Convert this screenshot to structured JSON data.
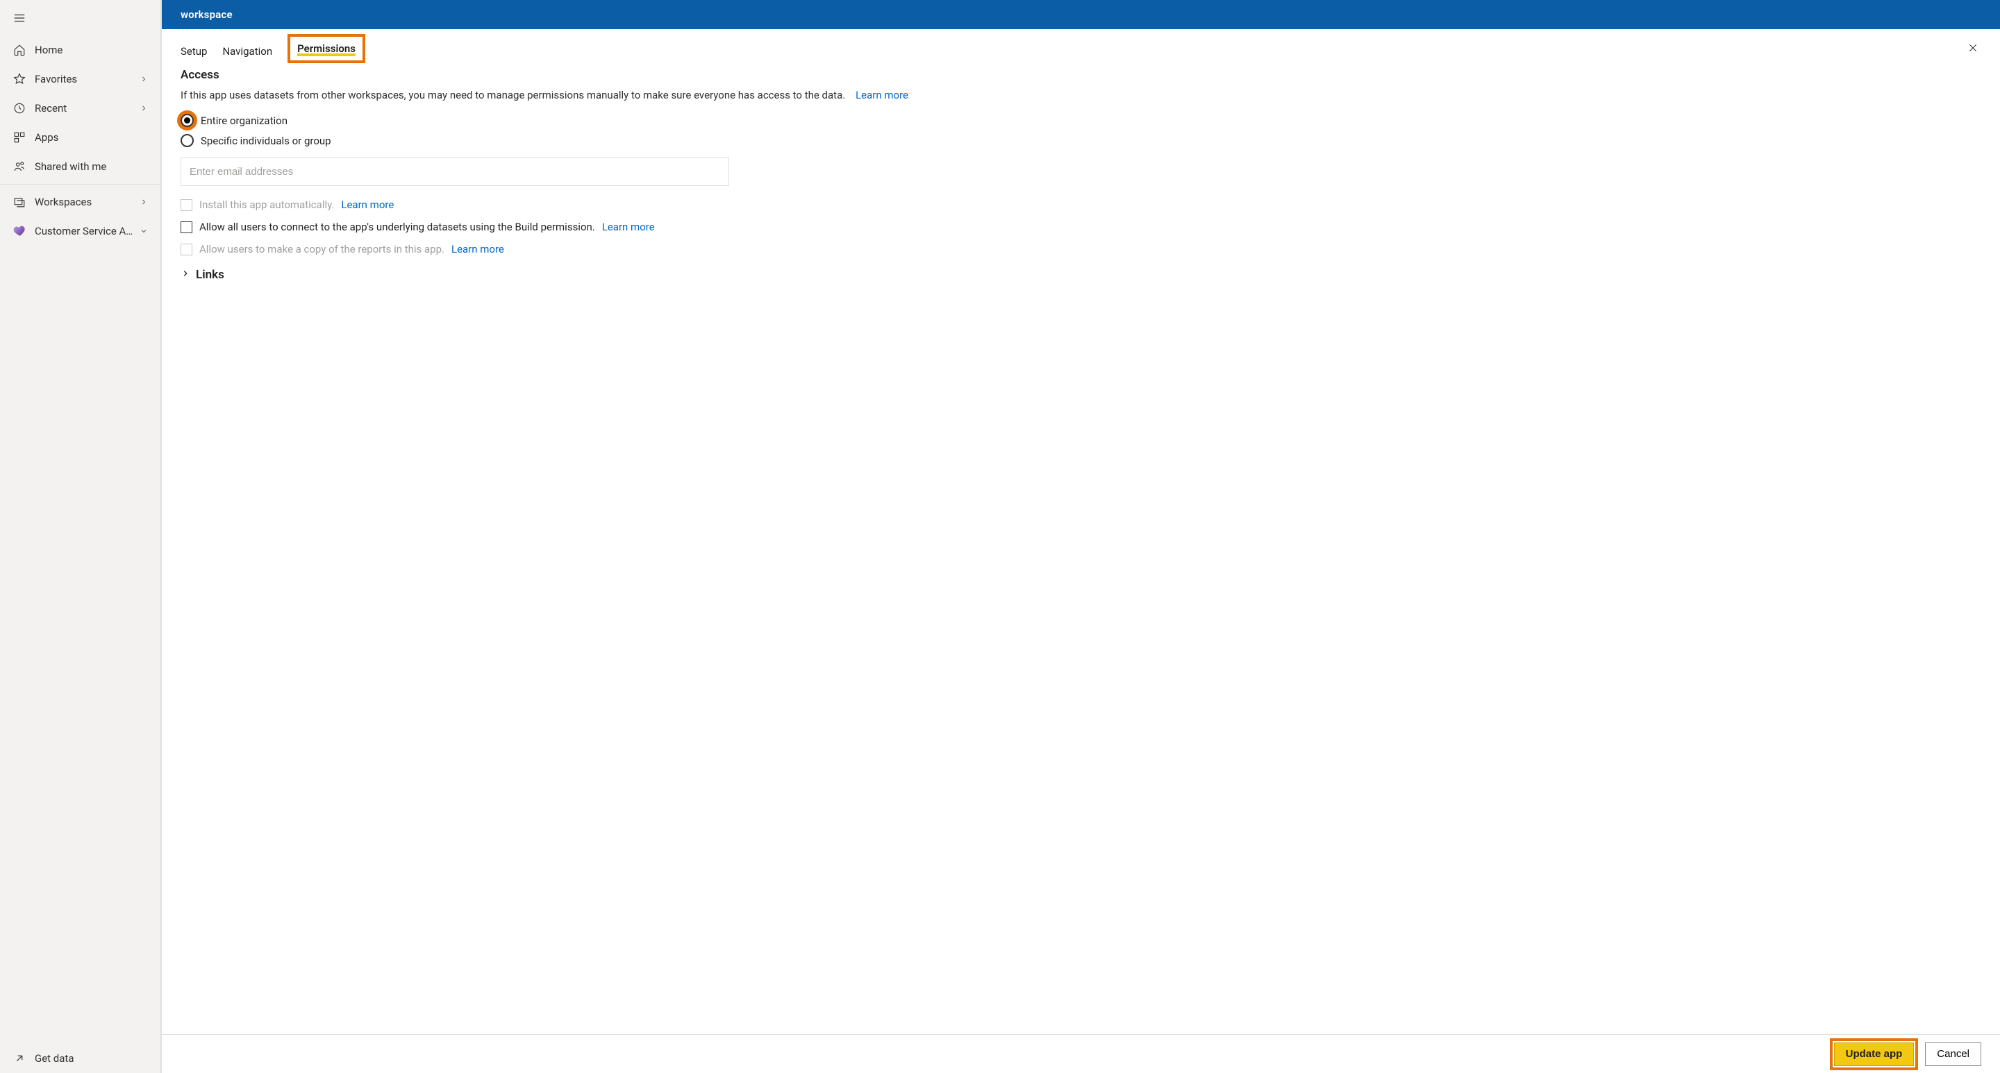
{
  "sidebar": {
    "items": [
      {
        "label": "Home"
      },
      {
        "label": "Favorites"
      },
      {
        "label": "Recent"
      },
      {
        "label": "Apps"
      },
      {
        "label": "Shared with me"
      }
    ],
    "workspaces_label": "Workspaces",
    "workspace_item": "Customer Service A…",
    "get_data_label": "Get data"
  },
  "header": {
    "title": "workspace"
  },
  "tabs": {
    "setup": "Setup",
    "navigation": "Navigation",
    "permissions": "Permissions"
  },
  "access": {
    "title": "Access",
    "description": "If this app uses datasets from other workspaces, you may need to manage permissions manually to make sure everyone has access to the data.",
    "learn_more": "Learn more",
    "radio_entire_org": "Entire organization",
    "radio_specific": "Specific individuals or group",
    "email_placeholder": "Enter email addresses",
    "checkbox_install": "Install this app automatically.",
    "checkbox_install_learn": "Learn more",
    "checkbox_build": "Allow all users to connect to the app's underlying datasets using the Build permission.",
    "checkbox_build_learn": "Learn more",
    "checkbox_copy": "Allow users to make a copy of the reports in this app.",
    "checkbox_copy_learn": "Learn more"
  },
  "links": {
    "title": "Links"
  },
  "footer": {
    "update": "Update app",
    "cancel": "Cancel"
  }
}
